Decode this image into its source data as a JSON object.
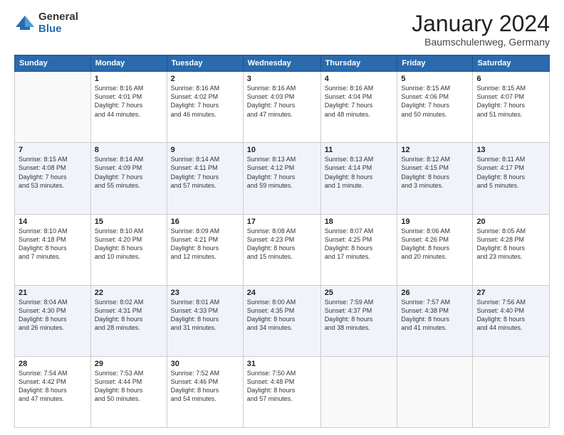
{
  "logo": {
    "general": "General",
    "blue": "Blue"
  },
  "title": "January 2024",
  "location": "Baumschulenweg, Germany",
  "days_header": [
    "Sunday",
    "Monday",
    "Tuesday",
    "Wednesday",
    "Thursday",
    "Friday",
    "Saturday"
  ],
  "weeks": [
    [
      {
        "num": "",
        "info": ""
      },
      {
        "num": "1",
        "info": "Sunrise: 8:16 AM\nSunset: 4:01 PM\nDaylight: 7 hours\nand 44 minutes."
      },
      {
        "num": "2",
        "info": "Sunrise: 8:16 AM\nSunset: 4:02 PM\nDaylight: 7 hours\nand 46 minutes."
      },
      {
        "num": "3",
        "info": "Sunrise: 8:16 AM\nSunset: 4:03 PM\nDaylight: 7 hours\nand 47 minutes."
      },
      {
        "num": "4",
        "info": "Sunrise: 8:16 AM\nSunset: 4:04 PM\nDaylight: 7 hours\nand 48 minutes."
      },
      {
        "num": "5",
        "info": "Sunrise: 8:15 AM\nSunset: 4:06 PM\nDaylight: 7 hours\nand 50 minutes."
      },
      {
        "num": "6",
        "info": "Sunrise: 8:15 AM\nSunset: 4:07 PM\nDaylight: 7 hours\nand 51 minutes."
      }
    ],
    [
      {
        "num": "7",
        "info": "Sunrise: 8:15 AM\nSunset: 4:08 PM\nDaylight: 7 hours\nand 53 minutes."
      },
      {
        "num": "8",
        "info": "Sunrise: 8:14 AM\nSunset: 4:09 PM\nDaylight: 7 hours\nand 55 minutes."
      },
      {
        "num": "9",
        "info": "Sunrise: 8:14 AM\nSunset: 4:11 PM\nDaylight: 7 hours\nand 57 minutes."
      },
      {
        "num": "10",
        "info": "Sunrise: 8:13 AM\nSunset: 4:12 PM\nDaylight: 7 hours\nand 59 minutes."
      },
      {
        "num": "11",
        "info": "Sunrise: 8:13 AM\nSunset: 4:14 PM\nDaylight: 8 hours\nand 1 minute."
      },
      {
        "num": "12",
        "info": "Sunrise: 8:12 AM\nSunset: 4:15 PM\nDaylight: 8 hours\nand 3 minutes."
      },
      {
        "num": "13",
        "info": "Sunrise: 8:11 AM\nSunset: 4:17 PM\nDaylight: 8 hours\nand 5 minutes."
      }
    ],
    [
      {
        "num": "14",
        "info": "Sunrise: 8:10 AM\nSunset: 4:18 PM\nDaylight: 8 hours\nand 7 minutes."
      },
      {
        "num": "15",
        "info": "Sunrise: 8:10 AM\nSunset: 4:20 PM\nDaylight: 8 hours\nand 10 minutes."
      },
      {
        "num": "16",
        "info": "Sunrise: 8:09 AM\nSunset: 4:21 PM\nDaylight: 8 hours\nand 12 minutes."
      },
      {
        "num": "17",
        "info": "Sunrise: 8:08 AM\nSunset: 4:23 PM\nDaylight: 8 hours\nand 15 minutes."
      },
      {
        "num": "18",
        "info": "Sunrise: 8:07 AM\nSunset: 4:25 PM\nDaylight: 8 hours\nand 17 minutes."
      },
      {
        "num": "19",
        "info": "Sunrise: 8:06 AM\nSunset: 4:26 PM\nDaylight: 8 hours\nand 20 minutes."
      },
      {
        "num": "20",
        "info": "Sunrise: 8:05 AM\nSunset: 4:28 PM\nDaylight: 8 hours\nand 23 minutes."
      }
    ],
    [
      {
        "num": "21",
        "info": "Sunrise: 8:04 AM\nSunset: 4:30 PM\nDaylight: 8 hours\nand 26 minutes."
      },
      {
        "num": "22",
        "info": "Sunrise: 8:02 AM\nSunset: 4:31 PM\nDaylight: 8 hours\nand 28 minutes."
      },
      {
        "num": "23",
        "info": "Sunrise: 8:01 AM\nSunset: 4:33 PM\nDaylight: 8 hours\nand 31 minutes."
      },
      {
        "num": "24",
        "info": "Sunrise: 8:00 AM\nSunset: 4:35 PM\nDaylight: 8 hours\nand 34 minutes."
      },
      {
        "num": "25",
        "info": "Sunrise: 7:59 AM\nSunset: 4:37 PM\nDaylight: 8 hours\nand 38 minutes."
      },
      {
        "num": "26",
        "info": "Sunrise: 7:57 AM\nSunset: 4:38 PM\nDaylight: 8 hours\nand 41 minutes."
      },
      {
        "num": "27",
        "info": "Sunrise: 7:56 AM\nSunset: 4:40 PM\nDaylight: 8 hours\nand 44 minutes."
      }
    ],
    [
      {
        "num": "28",
        "info": "Sunrise: 7:54 AM\nSunset: 4:42 PM\nDaylight: 8 hours\nand 47 minutes."
      },
      {
        "num": "29",
        "info": "Sunrise: 7:53 AM\nSunset: 4:44 PM\nDaylight: 8 hours\nand 50 minutes."
      },
      {
        "num": "30",
        "info": "Sunrise: 7:52 AM\nSunset: 4:46 PM\nDaylight: 8 hours\nand 54 minutes."
      },
      {
        "num": "31",
        "info": "Sunrise: 7:50 AM\nSunset: 4:48 PM\nDaylight: 8 hours\nand 57 minutes."
      },
      {
        "num": "",
        "info": ""
      },
      {
        "num": "",
        "info": ""
      },
      {
        "num": "",
        "info": ""
      }
    ]
  ]
}
